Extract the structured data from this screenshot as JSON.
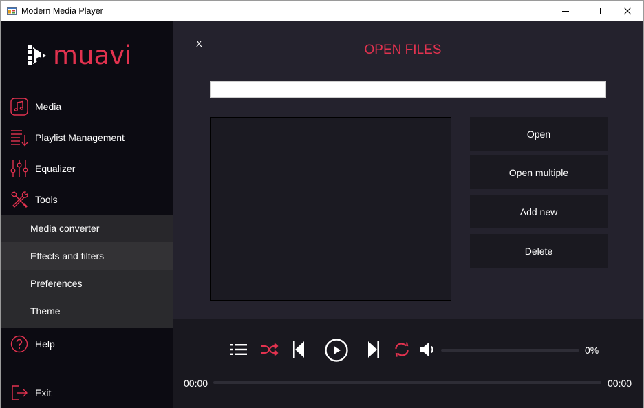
{
  "window": {
    "title": "Modern Media Player"
  },
  "logo": {
    "text": "muavi"
  },
  "colors": {
    "accent": "#e2324f",
    "sidebar_bg": "#0c0b12",
    "main_bg": "#24222d",
    "player_bg": "#19181f",
    "submenu_bg": "#2a2a2d"
  },
  "sidebar": {
    "items": [
      {
        "label": "Media",
        "icon": "music-note-icon"
      },
      {
        "label": "Playlist Management",
        "icon": "playlist-icon"
      },
      {
        "label": "Equalizer",
        "icon": "equalizer-icon"
      },
      {
        "label": "Tools",
        "icon": "tools-icon"
      }
    ],
    "submenu": [
      {
        "label": "Media converter"
      },
      {
        "label": "Effects and filters"
      },
      {
        "label": "Preferences"
      },
      {
        "label": "Theme"
      }
    ],
    "help": {
      "label": "Help",
      "icon": "help-icon"
    },
    "exit": {
      "label": "Exit",
      "icon": "exit-icon"
    }
  },
  "panel": {
    "close_label": "X",
    "title": "OPEN FILES",
    "path_value": "",
    "buttons": [
      {
        "label": "Open"
      },
      {
        "label": "Open multiple"
      },
      {
        "label": "Add new"
      },
      {
        "label": "Delete"
      }
    ]
  },
  "player": {
    "volume_fraction": 0,
    "volume_text": "0%",
    "progress_fraction": 0,
    "time_elapsed": "00:00",
    "time_total": "00:00",
    "controls": [
      "list-icon",
      "shuffle-icon",
      "previous-icon",
      "play-icon",
      "next-icon",
      "repeat-icon",
      "volume-icon"
    ]
  }
}
